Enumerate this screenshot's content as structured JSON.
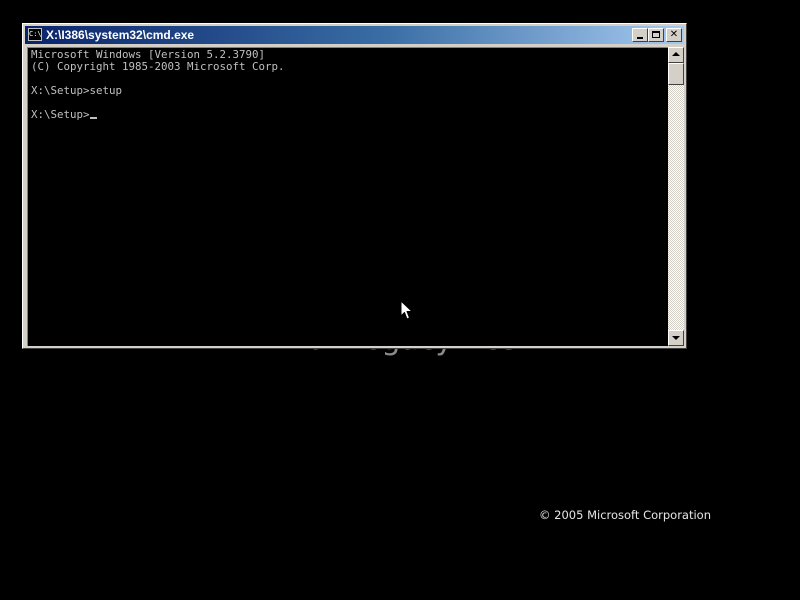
{
  "backdrop": {
    "partial_text": "for Legacy PCs",
    "copyright": "© 2005 Microsoft Corporation"
  },
  "window": {
    "title": "X:\\I386\\system32\\cmd.exe",
    "icon_text": "C:\\",
    "icon": "cmd-icon",
    "buttons": {
      "minimize": "minimize-icon",
      "maximize": "maximize-icon",
      "close_label": "✕"
    }
  },
  "console": {
    "lines": [
      "Microsoft Windows [Version 5.2.3790]",
      "(C) Copyright 1985-2003 Microsoft Corp.",
      "",
      "X:\\Setup>setup",
      "",
      "X:\\Setup>"
    ]
  },
  "colors": {
    "desktop_background": "#000000",
    "console_text": "#c0c0c0",
    "titlebar_start": "#0a246a",
    "titlebar_end": "#a6caf0"
  }
}
